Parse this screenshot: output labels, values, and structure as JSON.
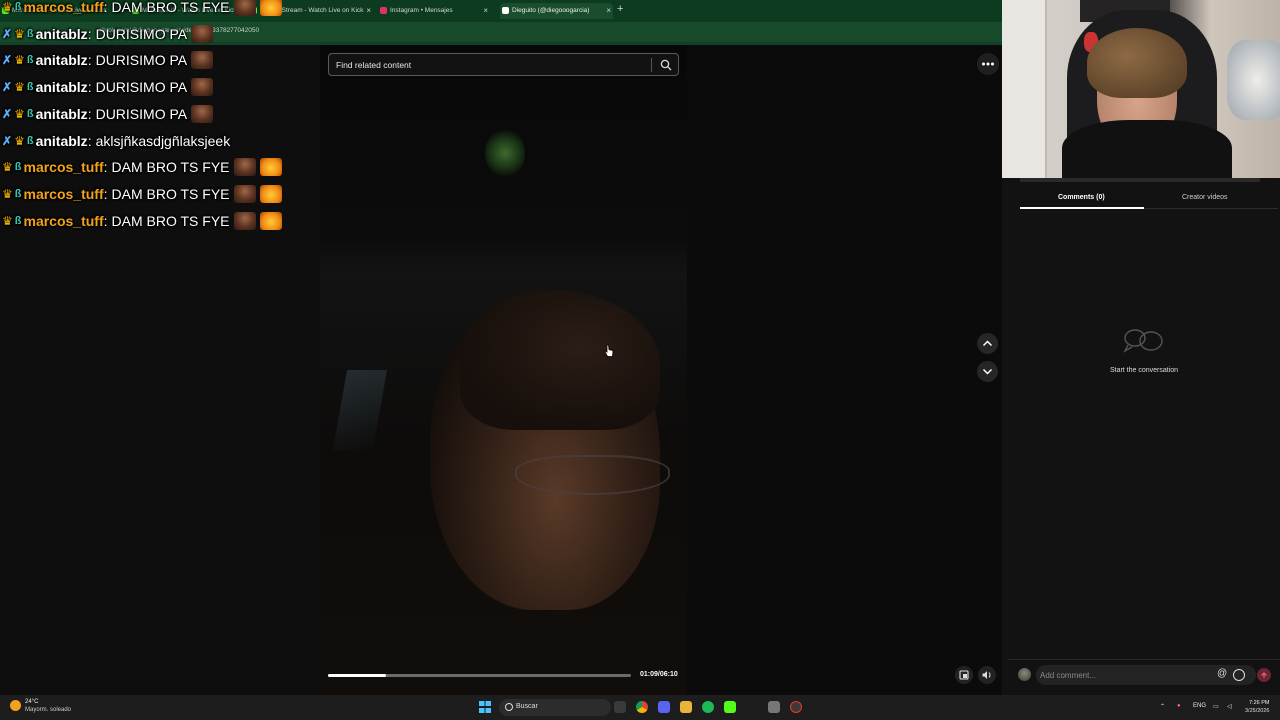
{
  "browser": {
    "tabs": [
      {
        "label": "Marcos Tuff - Watch Live on Kick",
        "icon": "kick-icon",
        "color": "#53fc18"
      },
      {
        "label": "Marcos Tuff - Watch Live on Kick",
        "icon": "kick-icon",
        "color": "#53fc18"
      },
      {
        "label": "Mantte Stream - Watch Live on Kick",
        "icon": "kick-icon",
        "color": "#53fc18"
      },
      {
        "label": "Instagram • Mensajes",
        "icon": "instagram-icon",
        "color": "#e1306c"
      },
      {
        "label": "Dieguito (@diegooogarcia)",
        "icon": "tiktok-icon",
        "color": "#ffffff"
      }
    ],
    "new_tab": "+",
    "url": "tiktok.com/@diegooogarcia/video/75213378277042050"
  },
  "video": {
    "search_placeholder": "Find related content",
    "time": "01:09/06:10",
    "progress": 0.19
  },
  "comments_panel": {
    "tab_comments": "Comments (0)",
    "tab_creator": "Creator videos",
    "empty_text": "Start the conversation",
    "input_placeholder": "Add comment...",
    "at_symbol": "@"
  },
  "chat": {
    "messages": [
      {
        "badges": [
          "crown",
          "sub"
        ],
        "user": "marcos_tuff",
        "user_color": "#f2a21c",
        "text": "DAM BRO TS FYE",
        "emotes": [
          "person",
          "money"
        ]
      },
      {
        "badges": [
          "sword",
          "crown",
          "sub"
        ],
        "user": "anitablz",
        "user_color": "#ffffff",
        "text": "DURISIMO PA",
        "emotes": [
          "person"
        ]
      },
      {
        "badges": [
          "sword",
          "crown",
          "sub"
        ],
        "user": "anitablz",
        "user_color": "#ffffff",
        "text": "DURISIMO PA",
        "emotes": [
          "person"
        ]
      },
      {
        "badges": [
          "sword",
          "crown",
          "sub"
        ],
        "user": "anitablz",
        "user_color": "#ffffff",
        "text": "DURISIMO PA",
        "emotes": [
          "person"
        ]
      },
      {
        "badges": [
          "sword",
          "crown",
          "sub"
        ],
        "user": "anitablz",
        "user_color": "#ffffff",
        "text": "DURISIMO PA",
        "emotes": [
          "person"
        ]
      },
      {
        "badges": [
          "sword",
          "crown",
          "sub"
        ],
        "user": "anitablz",
        "user_color": "#ffffff",
        "text": "aklsjñkasdjgñlaksjeek",
        "emotes": []
      },
      {
        "badges": [
          "crown",
          "sub"
        ],
        "user": "marcos_tuff",
        "user_color": "#f2a21c",
        "text": "DAM BRO TS FYE",
        "emotes": [
          "person",
          "money"
        ]
      },
      {
        "badges": [
          "crown",
          "sub"
        ],
        "user": "marcos_tuff",
        "user_color": "#f2a21c",
        "text": "DAM BRO TS FYE",
        "emotes": [
          "person",
          "money"
        ]
      },
      {
        "badges": [
          "crown",
          "sub"
        ],
        "user": "marcos_tuff",
        "user_color": "#f2a21c",
        "text": "DAM BRO TS FYE",
        "emotes": [
          "person",
          "money"
        ]
      }
    ]
  },
  "taskbar": {
    "weather_temp": "24°C",
    "weather_desc": "Mayorm. soleado",
    "search_label": "Buscar",
    "lang": "ENG",
    "time": "7:26 PM",
    "date": "3/25/2026"
  }
}
